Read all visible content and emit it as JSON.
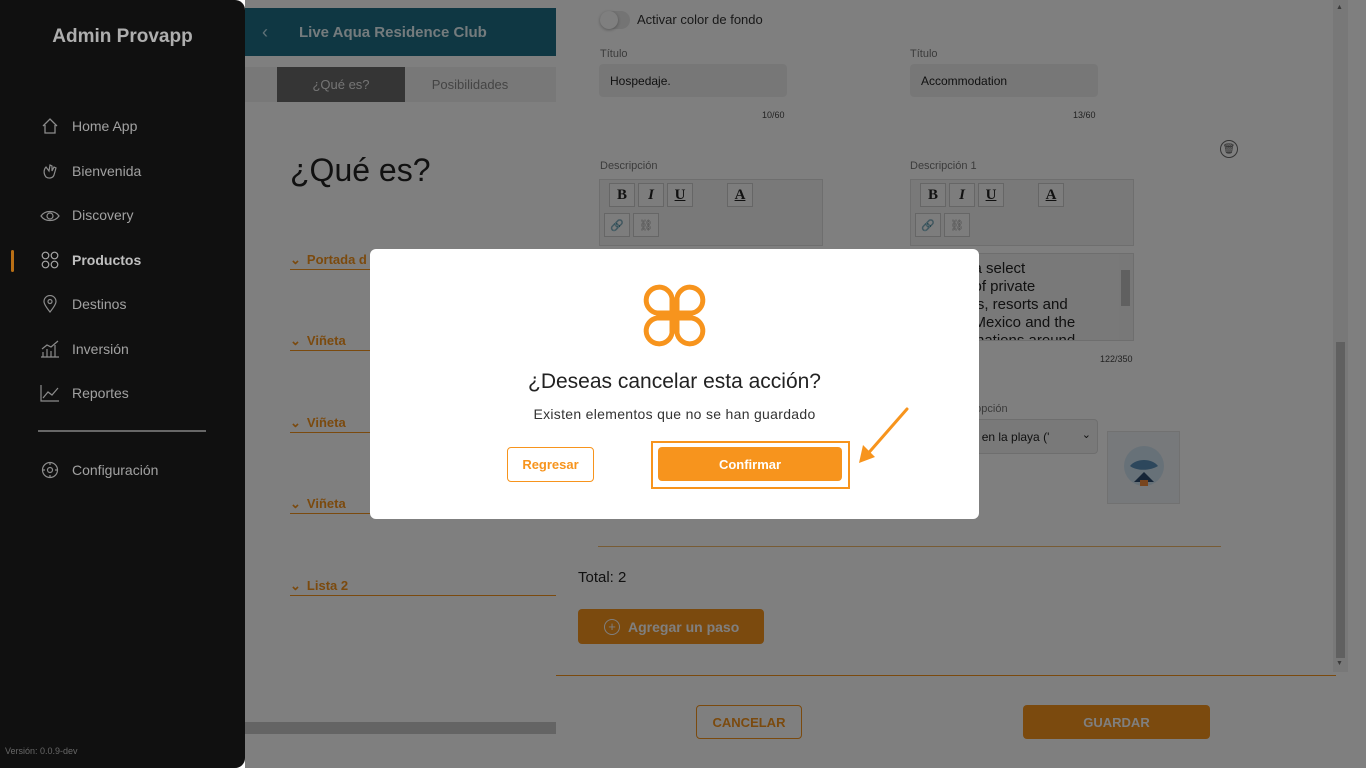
{
  "sidebar": {
    "brand": "Admin Provapp",
    "items": [
      {
        "label": "Home App",
        "icon": "home-icon"
      },
      {
        "label": "Bienvenida",
        "icon": "hand-wave-icon"
      },
      {
        "label": "Discovery",
        "icon": "eye-icon"
      },
      {
        "label": "Productos",
        "icon": "grid-icon",
        "active": true
      },
      {
        "label": "Destinos",
        "icon": "map-pin-icon"
      },
      {
        "label": "Inversión",
        "icon": "bar-chart-icon"
      },
      {
        "label": "Reportes",
        "icon": "line-chart-icon"
      }
    ],
    "settings": {
      "label": "Configuración",
      "icon": "gear-icon"
    },
    "version": "Versión: 0.0.9-dev"
  },
  "background_page": {
    "title": "Live Aqua Residence Club",
    "tabs": [
      "¿Qué es?",
      "Posibilidades"
    ],
    "heading": "¿Qué es?",
    "accordions": [
      "Portada d",
      "Viñeta",
      "Viñeta",
      "Viñeta",
      "Lista 2"
    ]
  },
  "form": {
    "toggle_label": "Activar color de fondo",
    "title_label": "Título",
    "title_es": "Hospedaje.",
    "title_es_count": "10/60",
    "title_en": "Accommodation",
    "title_en_count": "13/60",
    "desc_label": "Descripción",
    "desc1_label": "Descripción 1",
    "toolbar": {
      "bold": "B",
      "italic": "I",
      "underline": "U",
      "color": "A"
    },
    "desc1_text": "e a select\no of private\nces, resorts and\nn Mexico and the\nstinations around",
    "desc1_count": "122/350",
    "option_label": "a opción",
    "option_value": "tada en la playa ('",
    "total": "Total: 2",
    "add_step": "Agregar un paso",
    "cancel": "CANCELAR",
    "save": "GUARDAR"
  },
  "modal": {
    "title": "¿Deseas cancelar esta acción?",
    "subtitle": "Existen elementos que no se han guardado",
    "back_button": "Regresar",
    "confirm_button": "Confirmar"
  },
  "colors": {
    "accent": "#f7941d",
    "sidebar": "#161616",
    "header": "#1f6e86"
  }
}
